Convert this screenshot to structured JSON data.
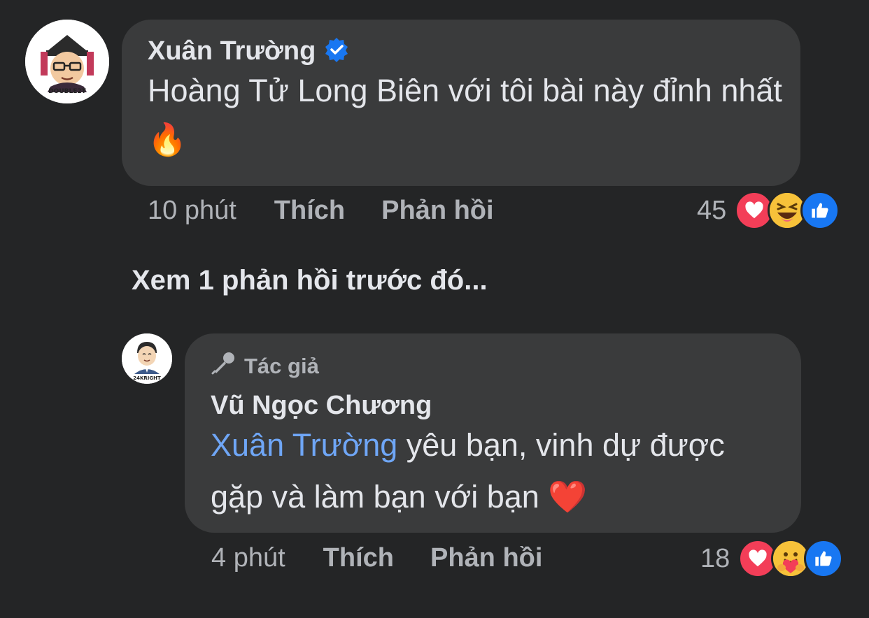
{
  "comments": [
    {
      "author": "Xuân Trường",
      "verified": true,
      "text": "Hoàng Tử Long Biên với tôi bài này đỉnh nhất",
      "emoji": "🔥",
      "avatar_label": "DOUBLE2T",
      "time": "10 phút",
      "like_label": "Thích",
      "reply_label": "Phản hồi",
      "reaction_count": "45",
      "reactions": [
        "love-icon",
        "haha-icon",
        "like-icon"
      ]
    },
    {
      "badge": "Tác giả",
      "author": "Vũ Ngọc Chương",
      "mention": "Xuân Trường",
      "text": " yêu bạn, vinh dự được gặp và làm bạn với bạn",
      "emoji": "❤️",
      "avatar_label": "24KRIGHT",
      "time": "4 phút",
      "like_label": "Thích",
      "reply_label": "Phản hồi",
      "reaction_count": "18",
      "reactions": [
        "love-icon",
        "care-icon",
        "like-icon"
      ]
    }
  ],
  "see_previous_replies": "Xem 1 phản hồi trước đó...",
  "colors": {
    "background": "#242526",
    "bubble": "#3a3b3c",
    "mention": "#6fa6f6",
    "like_blue": "#1877f2",
    "love_red": "#f33e58"
  }
}
